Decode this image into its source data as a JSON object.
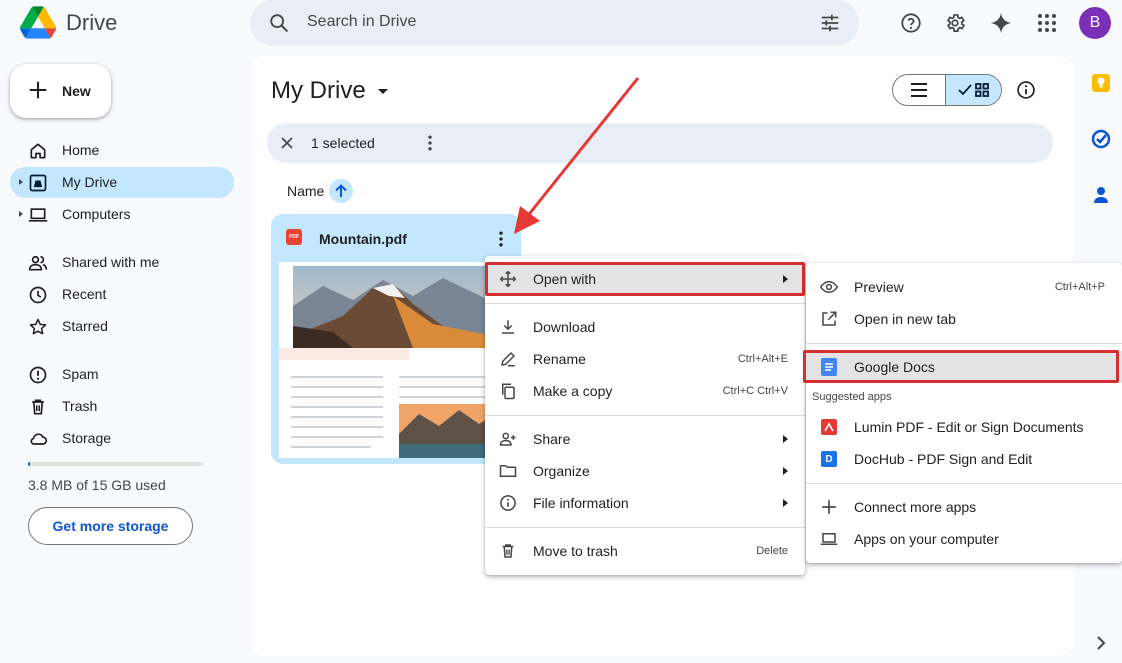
{
  "header": {
    "logo_text": "Drive",
    "search_placeholder": "Search in Drive",
    "avatar_letter": "B"
  },
  "sidebar": {
    "new_label": "New",
    "items": [
      {
        "label": "Home",
        "icon": "home-icon"
      },
      {
        "label": "My Drive",
        "icon": "my-drive-icon",
        "active": true
      },
      {
        "label": "Computers",
        "icon": "computer-icon"
      },
      {
        "label": "Shared with me",
        "icon": "shared-people-icon"
      },
      {
        "label": "Recent",
        "icon": "clock-icon"
      },
      {
        "label": "Starred",
        "icon": "star-icon"
      },
      {
        "label": "Spam",
        "icon": "spam-icon"
      },
      {
        "label": "Trash",
        "icon": "trash-icon"
      },
      {
        "label": "Storage",
        "icon": "cloud-icon"
      }
    ],
    "storage_text": "3.8 MB of 15 GB used",
    "storage_used_fraction": 0.0003,
    "get_storage_label": "Get more storage"
  },
  "main": {
    "title": "My Drive",
    "selection_text": "1 selected",
    "name_header": "Name",
    "file": {
      "name": "Mountain.pdf",
      "type_badge": "PDF"
    }
  },
  "context_menu": {
    "items": [
      {
        "label": "Open with",
        "submenu": true,
        "highlighted": true
      },
      {
        "label": "Download"
      },
      {
        "label": "Rename",
        "shortcut": "Ctrl+Alt+E"
      },
      {
        "label": "Make a copy",
        "shortcut": "Ctrl+C Ctrl+V"
      },
      {
        "label": "Share",
        "submenu": true
      },
      {
        "label": "Organize",
        "submenu": true
      },
      {
        "label": "File information",
        "submenu": true
      },
      {
        "label": "Move to trash",
        "shortcut": "Delete"
      }
    ]
  },
  "open_with_menu": {
    "preview": {
      "label": "Preview",
      "shortcut": "Ctrl+Alt+P"
    },
    "new_tab": {
      "label": "Open in new tab"
    },
    "google_docs": {
      "label": "Google Docs"
    },
    "suggested_label": "Suggested apps",
    "lumin": {
      "label": "Lumin PDF - Edit or Sign Documents"
    },
    "dochub": {
      "label": "DocHub - PDF Sign and Edit",
      "badge": "D"
    },
    "connect": {
      "label": "Connect more apps"
    },
    "computer_apps": {
      "label": "Apps on your computer"
    }
  },
  "colors": {
    "accent": "#0b57d0",
    "selected_bg": "#c2e7ff",
    "highlight_box": "#d32f2f",
    "arrow": "#e53935"
  }
}
